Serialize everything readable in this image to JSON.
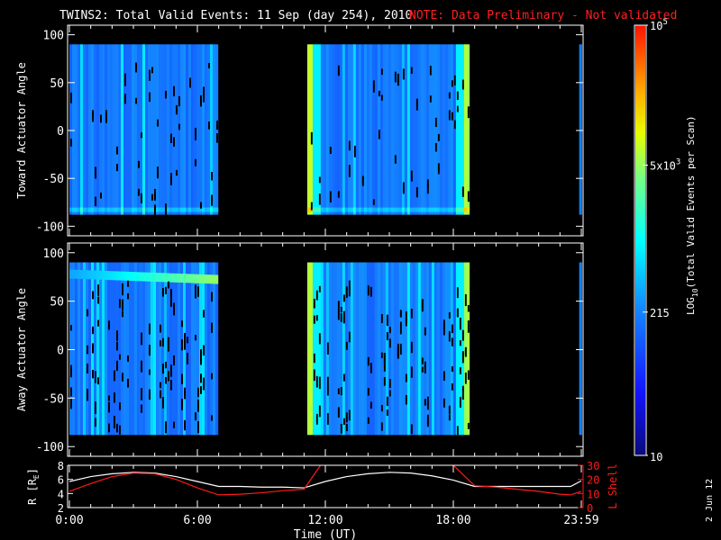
{
  "chart_data": {
    "type": "heatmap",
    "title": "TWINS2: Total Valid Events: 11 Sep (day 254), 2010",
    "note": "NOTE: Data Preliminary - Not validated",
    "xlabel": "Time (UT)",
    "x_ticks": [
      "0:00",
      "6:00",
      "12:00",
      "18:00",
      "23:59"
    ],
    "x_tick_hours": [
      0,
      6,
      12,
      18,
      24
    ],
    "xlim_hours": [
      0,
      24
    ],
    "data_intervals_hours": [
      [
        0,
        6.9
      ],
      [
        11.15,
        18.7
      ],
      [
        23.9,
        24
      ]
    ],
    "panels": [
      {
        "ylabel": "Toward Actuator Angle",
        "ylim": [
          -110,
          110
        ],
        "y_ticks": [
          100,
          50,
          0,
          -50,
          -100
        ],
        "angle_range": [
          -88,
          90
        ],
        "saturated_band": "low"
      },
      {
        "ylabel": "Away Actuator Angle",
        "ylim": [
          -110,
          110
        ],
        "y_ticks": [
          100,
          50,
          0,
          -50,
          -100
        ],
        "angle_range": [
          -88,
          90
        ],
        "saturated_band": "high"
      }
    ],
    "colorbar": {
      "label": "LOG10(Total Valid Events per Scan)",
      "label_main": "LOG",
      "label_sub": "10",
      "label_rest": "(Total Valid Events per Scan)",
      "range": [
        10,
        100000
      ],
      "ticks": [
        {
          "value": 10,
          "label": "10"
        },
        {
          "value": 215,
          "label": "215"
        },
        {
          "value": 5000,
          "label": "5x10",
          "sup": "3"
        },
        {
          "value": 100000,
          "label": "10",
          "sup": "5"
        }
      ]
    },
    "ephemeris": {
      "ylabel_left": "R [R",
      "ylabel_left_sub": "E",
      "ylabel_left_end": "]",
      "ylim_left": [
        2,
        8
      ],
      "y_ticks_left": [
        "8",
        "6",
        "4",
        "2"
      ],
      "ylabel_right": "L Shell",
      "ylim_right": [
        0,
        30
      ],
      "y_ticks_right": [
        "30",
        "20",
        "10",
        "0"
      ],
      "hours": [
        0,
        1,
        2,
        3,
        4,
        5,
        6,
        7,
        8,
        9,
        10,
        11,
        12,
        13,
        14,
        15,
        16,
        17,
        18,
        19,
        20,
        21,
        22,
        23,
        23.5,
        24
      ],
      "R": [
        5.7,
        6.4,
        6.8,
        7.0,
        6.9,
        6.4,
        5.7,
        5.0,
        5.0,
        4.9,
        4.9,
        4.8,
        5.7,
        6.4,
        6.8,
        7.0,
        6.9,
        6.5,
        5.9,
        5.0,
        5.0,
        5.0,
        5.0,
        5.0,
        5.0,
        5.8
      ],
      "L": [
        11.5,
        17,
        22,
        24.5,
        24,
        20,
        14,
        9,
        9.5,
        10.5,
        12,
        13,
        35,
        40,
        40,
        40,
        40,
        40,
        30,
        15.5,
        14.5,
        13,
        11.5,
        9.5,
        9,
        11.5
      ]
    }
  },
  "footer": {
    "date_stamp": "2 Jun 12"
  }
}
